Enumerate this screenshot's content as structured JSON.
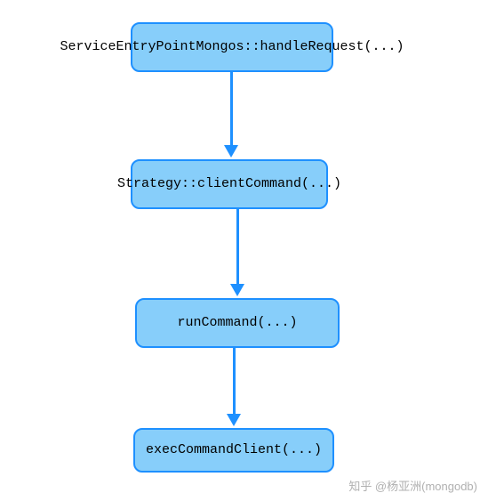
{
  "chart_data": {
    "type": "flowchart",
    "direction": "top-to-bottom",
    "nodes": [
      {
        "id": "n1",
        "label": "ServiceEntryPointMongos::handleRequest(...)"
      },
      {
        "id": "n2",
        "label": "Strategy::clientCommand(...)"
      },
      {
        "id": "n3",
        "label": "runCommand(...)"
      },
      {
        "id": "n4",
        "label": "execCommandClient(...)"
      }
    ],
    "edges": [
      {
        "from": "n1",
        "to": "n2"
      },
      {
        "from": "n2",
        "to": "n3"
      },
      {
        "from": "n3",
        "to": "n4"
      }
    ],
    "colors": {
      "node_fill": "#87cefa",
      "node_border": "#1e90ff",
      "arrow": "#1e90ff"
    }
  },
  "watermark": "知乎 @杨亚洲(mongodb)"
}
